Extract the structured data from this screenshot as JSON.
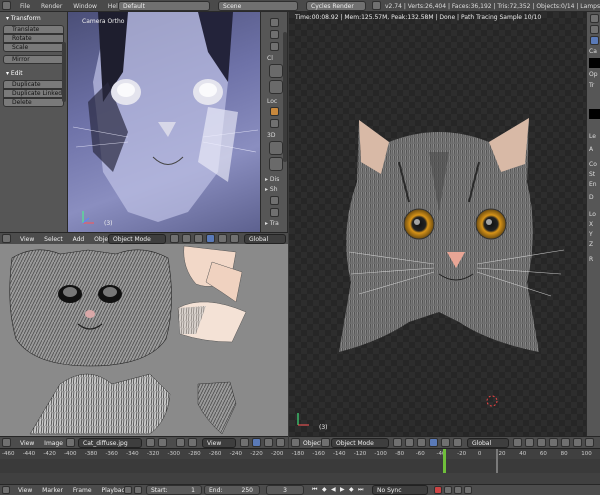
{
  "top_menu": {
    "items": [
      "File",
      "Render",
      "Window",
      "Help"
    ]
  },
  "screen_layout": "Default",
  "scene": "Scene",
  "render_engine": "Cycles Render",
  "stats": "v2.74 | Verts:26,404 | Faces:36,192 | Tris:72,352 | Objects:0/14 | Lamps:0/0 | Mem:...",
  "tool_shelf": {
    "transform_title": "Transform",
    "transform_buttons": [
      "Translate",
      "Rotate",
      "Scale"
    ],
    "mirror": "Mirror",
    "edit_title": "Edit",
    "edit_buttons": [
      "Duplicate",
      "Duplicate Linked",
      "Delete"
    ]
  },
  "camera_view": {
    "label": "Camera Ortho",
    "frame": "(3)"
  },
  "render_view": {
    "status": "Time:00:08.92 | Mem:125.57M, Peak:132.58M | Done | Path Tracing Sample 10/10",
    "frame": "(3)"
  },
  "top_left_header": {
    "items": [
      "View",
      "Select",
      "Add",
      "Object"
    ],
    "mode": "Object Mode",
    "orientation": "Global"
  },
  "right_viewport_header": {
    "object": "Object",
    "mode": "Object Mode",
    "orientation": "Global"
  },
  "uv_header": {
    "items": [
      "View",
      "Image"
    ],
    "image_name": "Cat_diffuse.jpg",
    "view": "View"
  },
  "timeline": {
    "ticks": [
      "-460",
      "-440",
      "-420",
      "-400",
      "-380",
      "-360",
      "-340",
      "-320",
      "-300",
      "-280",
      "-260",
      "-240",
      "-220",
      "-200",
      "-180",
      "-160",
      "-140",
      "-120",
      "-100",
      "-80",
      "-60",
      "-40",
      "-20",
      "0",
      "20",
      "40",
      "60",
      "80",
      "100"
    ],
    "menu": [
      "View",
      "Marker",
      "Frame",
      "Playback"
    ],
    "start_label": "Start:",
    "start_value": "1",
    "end_label": "End:",
    "end_value": "250",
    "current_frame": "3",
    "sync": "No Sync"
  },
  "side_panel_labels": {
    "cl": "Cl",
    "loc": "Loc",
    "d3": "3D",
    "dis": "Dis",
    "sh": "Sh",
    "tra": "Tra"
  },
  "props_labels": {
    "ca": "Ca",
    "op": "Op",
    "tr": "Tr",
    "le": "Le",
    "a": "A",
    "co": "Co",
    "st": "St",
    "en": "En",
    "d": "D",
    "lo": "Lo",
    "x": "X",
    "y": "Y",
    "z": "Z",
    "r": "R"
  }
}
